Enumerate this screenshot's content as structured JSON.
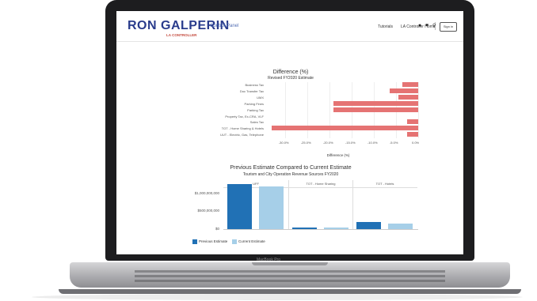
{
  "header": {
    "brand_left": "RON",
    "brand_right": "GALPERIN",
    "brand_sub": "LA CONTROLLER",
    "control_panel": "Control Panel",
    "nav": [
      "Tutorials",
      "LA Controller Home"
    ],
    "signin": "Sign in"
  },
  "device": {
    "model": "MacBook Pro"
  },
  "diff_chart": {
    "title": "Difference (%)",
    "subtitle": "Revised FY2020 Estimate",
    "xlabel": "Difference (%)"
  },
  "ticks_diff": [
    "-30.0%",
    "-25.0%",
    "-20.0%",
    "-15.0%",
    "-10.0%",
    "-5.0%",
    "0.0%"
  ],
  "compare_chart": {
    "title": "Previous Estimate Compared to Current Estimate",
    "subtitle": "Tourism and City Operation Revenue Sources FY2020",
    "panels": [
      "UFF",
      "TOT - Home Sharing",
      "TOT - Hotels"
    ],
    "y_ticks": [
      "$1,000,000,000",
      "$500,000,000",
      "$0"
    ],
    "legend": [
      "Previous Estimate",
      "Current Estimate"
    ]
  },
  "colors": {
    "negative_bar": "#e57373",
    "previous": "#2171b5",
    "current": "#a6cfe8",
    "brand": "#2a3c8c"
  },
  "chart_data": [
    {
      "type": "bar",
      "orientation": "horizontal",
      "title": "Difference (%)",
      "subtitle": "Revised FY2020 Estimate",
      "xlabel": "Difference (%)",
      "categories": [
        "Business Tax",
        "Doc Transfer Tax",
        "UMX",
        "Parking Fines",
        "Parking Tax",
        "Property Tax, Ex-CRA, VLF",
        "Sales Tax",
        "TOT - Home Sharing & Hotels",
        "UUT - Electric, Gas, Telephone"
      ],
      "values": [
        -3.5,
        -6.5,
        -4.5,
        -19.0,
        -19.0,
        0,
        -2.5,
        -33.0,
        -2.5
      ],
      "xlim": [
        -33,
        0
      ]
    },
    {
      "type": "bar",
      "title": "Previous Estimate Compared to Current Estimate",
      "subtitle": "Tourism and City Operation Revenue Sources FY2020",
      "categories": [
        "UFF",
        "TOT - Home Sharing",
        "TOT - Hotels"
      ],
      "series": [
        {
          "name": "Previous Estimate",
          "values": [
            1250000000,
            50000000,
            200000000
          ]
        },
        {
          "name": "Current Estimate",
          "values": [
            1180000000,
            40000000,
            160000000
          ]
        }
      ],
      "ylim": [
        0,
        1300000000
      ]
    }
  ]
}
